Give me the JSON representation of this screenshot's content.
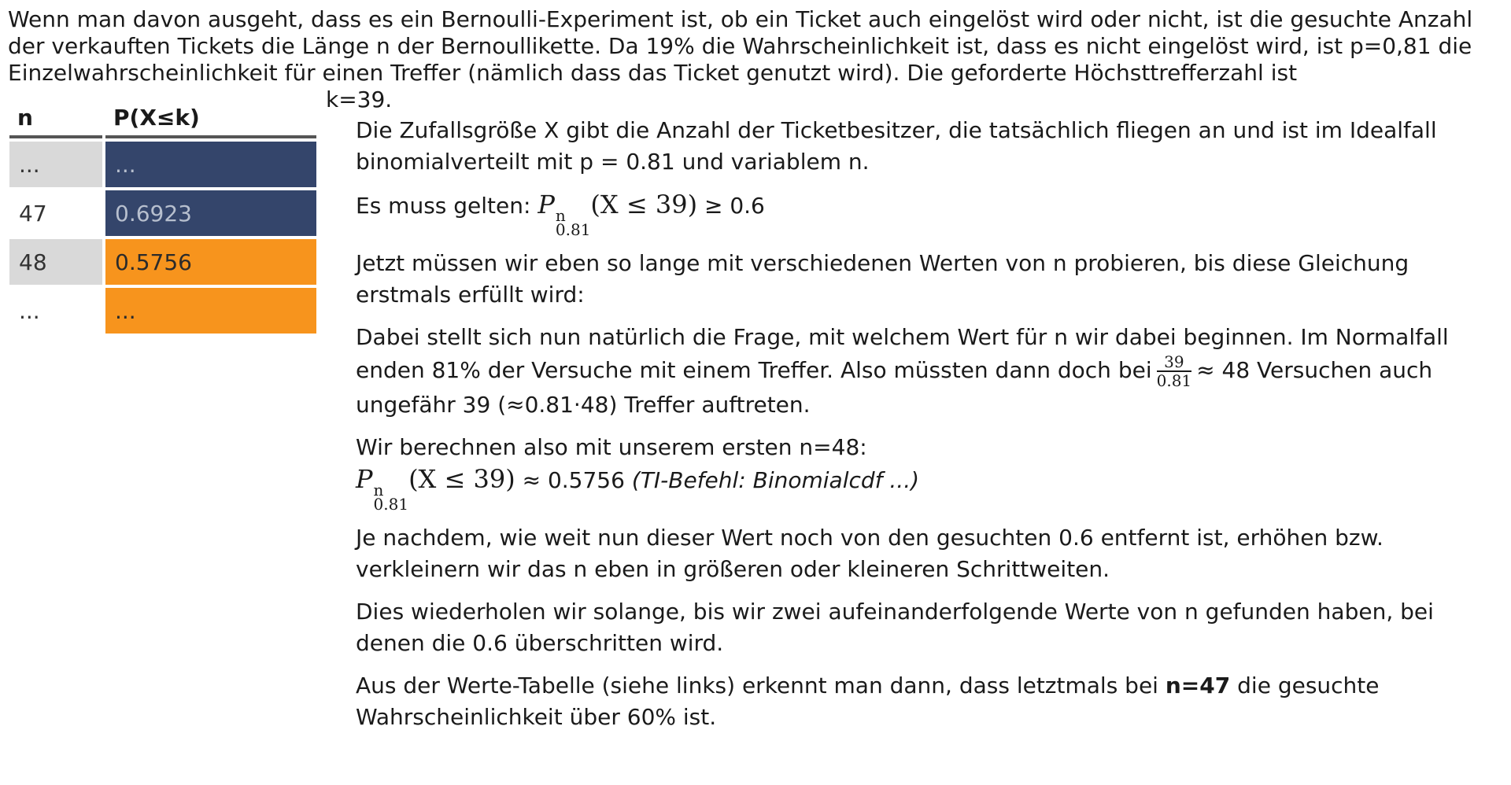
{
  "intro": {
    "main": "Wenn man davon ausgeht, dass es ein Bernoulli-Experiment ist, ob ein Ticket auch eingelöst wird oder nicht, ist die gesuchte Anzahl der verkauften Tickets die Länge n der Bernoullikette. Da 19% die Wahrscheinlichkeit ist, dass es nicht eingelöst wird, ist p=0,81 die Einzelwahrscheinlichkeit für einen Treffer (nämlich dass das Ticket genutzt wird). Die geforderte Höchsttrefferzahl ist",
    "k_line": "k=39."
  },
  "table": {
    "headers": [
      "n",
      "P(X≤k)"
    ],
    "rows": [
      {
        "n": "...",
        "p": "...",
        "n_style": "gray",
        "p_style": "blue"
      },
      {
        "n": "47",
        "p": "0.6923",
        "n_style": "white",
        "p_style": "blue"
      },
      {
        "n": "48",
        "p": "0.5756",
        "n_style": "gray",
        "p_style": "orange"
      },
      {
        "n": "...",
        "p": "...",
        "n_style": "white",
        "p_style": "orange"
      }
    ]
  },
  "colors": {
    "blue_cell": "#34456b",
    "orange_cell": "#f7941d",
    "gray_cell": "#d9d9d9",
    "header_rule": "#555555"
  },
  "explanation": {
    "p1": "Die Zufallsgröße X gibt die Anzahl der Ticketbesitzer, die tatsächlich fliegen an und ist im Idealfall binomialverteilt mit p = 0.81 und variablem n.",
    "p2_prefix": "Es muss gelten:",
    "formula_P": "P",
    "formula_sub": "0.81",
    "formula_sup": "n",
    "formula_body": "(X ≤ 39)",
    "p2_suffix": "≥ 0.6",
    "p3": "Jetzt müssen wir eben so lange mit verschiedenen Werten von n probieren, bis diese Gleichung erstmals erfüllt wird:",
    "p4_part1": "Dabei stellt sich nun natürlich die Frage, mit welchem Wert für n wir dabei beginnen. Im Normalfall enden 81% der Versuche mit einem Treffer. Also müssten dann doch bei",
    "p4_frac_num": "39",
    "p4_frac_den": "0.81",
    "p4_part2": "≈ 48 Versuchen auch ungefähr 39 (≈0.81⋅48) Treffer auftreten.",
    "p5_line1": "Wir berechnen also mit unserem ersten n=48:",
    "p5_result": "≈ 0.5756",
    "p5_ti": "(TI-Befehl: Binomialcdf ...)",
    "p6": "Je nachdem, wie weit nun dieser Wert noch von den gesuchten 0.6 entfernt ist, erhöhen bzw. verkleinern wir das n eben in größeren oder kleineren Schrittweiten.",
    "p7": "Dies wiederholen wir solange, bis wir zwei aufeinanderfolgende Werte von n gefunden haben, bei denen die 0.6 überschritten wird.",
    "p8_before": "Aus der Werte-Tabelle (siehe links) erkennt man dann, dass letztmals bei",
    "p8_bold": "n=47",
    "p8_after": "die gesuchte Wahrscheinlichkeit über 60% ist."
  }
}
